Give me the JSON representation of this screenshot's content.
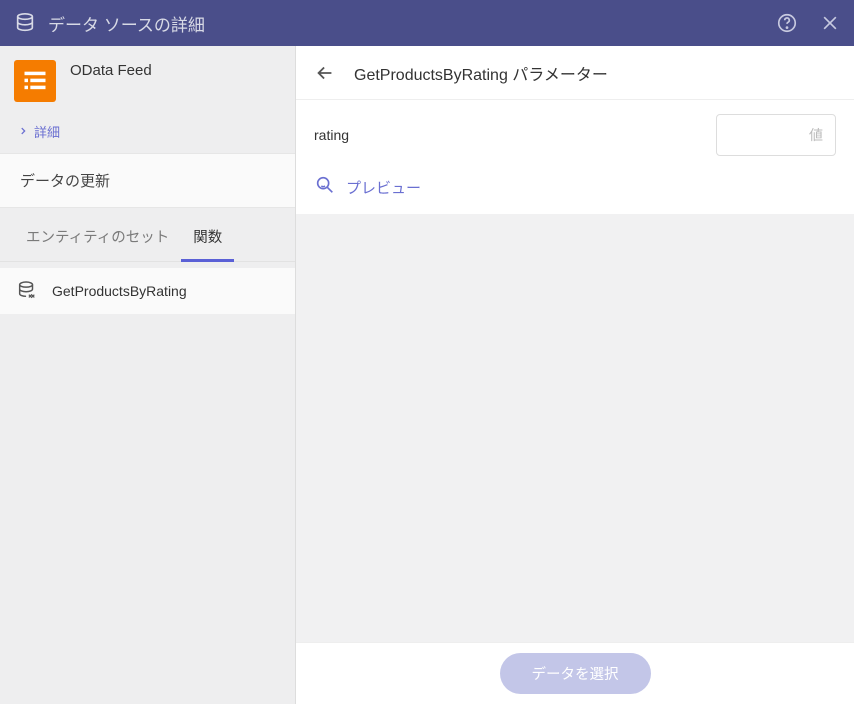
{
  "titlebar": {
    "title": "データ ソースの詳細"
  },
  "sidebar": {
    "datasource": {
      "name": "OData Feed",
      "url": ""
    },
    "details_link": "詳細",
    "refresh_label": "データの更新",
    "tabs": {
      "entity_set": "エンティティのセット",
      "functions": "関数"
    },
    "functions": [
      {
        "name": "GetProductsByRating"
      }
    ]
  },
  "main": {
    "title": "GetProductsByRating パラメーター",
    "params": [
      {
        "name": "rating",
        "placeholder": "値"
      }
    ],
    "preview_label": "プレビュー",
    "footer_button": "データを選択"
  },
  "colors": {
    "primary": "#5a60d6",
    "titlebar": "#4a4e8a",
    "accent_orange": "#f57c00"
  }
}
